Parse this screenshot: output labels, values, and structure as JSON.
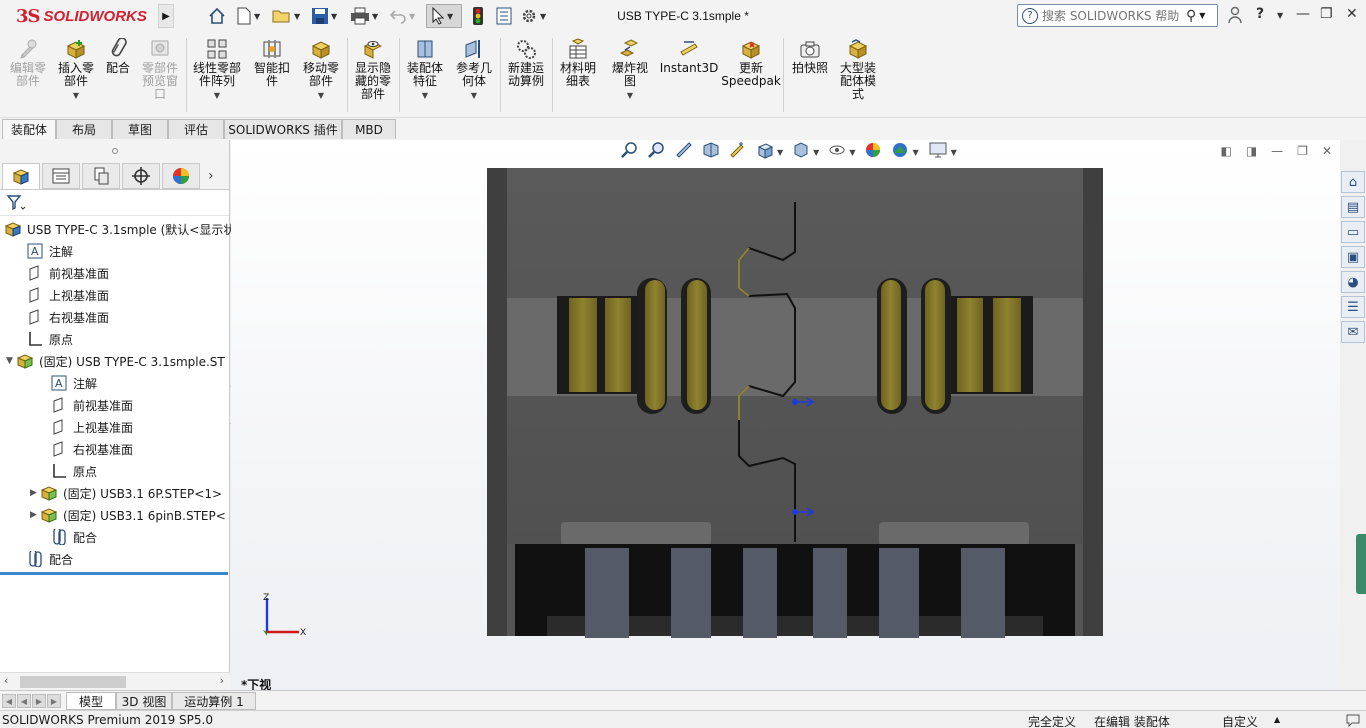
{
  "app": {
    "brand_ds": "3S",
    "brand_name": "SOLIDWORKS"
  },
  "title_bar": {
    "document_title": "USB TYPE-C 3.1smple *",
    "search_placeholder": "搜索 SOLIDWORKS 帮助"
  },
  "ribbon": {
    "buttons": [
      {
        "label": "编辑零\n部件",
        "icon": "edit-component-icon",
        "enabled": false
      },
      {
        "label": "插入零\n部件",
        "icon": "insert-component-icon",
        "enabled": true
      },
      {
        "label": "配合",
        "icon": "mate-icon",
        "enabled": true
      },
      {
        "label": "零部件\n预览窗\n口",
        "icon": "component-preview-icon",
        "enabled": false
      },
      {
        "label": "线性零部\n件阵列",
        "icon": "linear-pattern-icon",
        "enabled": true
      },
      {
        "label": "智能扣\n件",
        "icon": "smart-fasteners-icon",
        "enabled": true
      },
      {
        "label": "移动零\n部件",
        "icon": "move-component-icon",
        "enabled": true
      },
      {
        "label": "显示隐\n藏的零\n部件",
        "icon": "show-hidden-icon",
        "enabled": true
      },
      {
        "label": "装配体\n特征",
        "icon": "assembly-features-icon",
        "enabled": true
      },
      {
        "label": "参考几\n何体",
        "icon": "reference-geometry-icon",
        "enabled": true
      },
      {
        "label": "新建运\n动算例",
        "icon": "new-motion-study-icon",
        "enabled": true
      },
      {
        "label": "材料明\n细表",
        "icon": "bom-icon",
        "enabled": true
      },
      {
        "label": "爆炸视\n图",
        "icon": "exploded-view-icon",
        "enabled": true
      },
      {
        "label": "Instant3D",
        "icon": "instant3d-icon",
        "enabled": true
      },
      {
        "label": "更新\nSpeedpak",
        "icon": "speedpak-icon",
        "enabled": true
      },
      {
        "label": "拍快照",
        "icon": "snapshot-icon",
        "enabled": true
      },
      {
        "label": "大型装\n配体模\n式",
        "icon": "large-assembly-icon",
        "enabled": true
      }
    ]
  },
  "tabs": [
    "装配体",
    "布局",
    "草图",
    "评估",
    "SOLIDWORKS 插件",
    "MBD"
  ],
  "feature_tree": {
    "root": "USB TYPE-C 3.1smple  (默认<显示状",
    "items": [
      {
        "label": "注解",
        "icon": "annotation-icon"
      },
      {
        "label": "前视基准面",
        "icon": "plane-icon"
      },
      {
        "label": "上视基准面",
        "icon": "plane-icon"
      },
      {
        "label": "右视基准面",
        "icon": "plane-icon"
      },
      {
        "label": "原点",
        "icon": "origin-icon"
      },
      {
        "label": "(固定) USB TYPE-C 3.1smple.ST",
        "icon": "subassembly-icon"
      },
      {
        "label": "注解",
        "icon": "annotation-icon"
      },
      {
        "label": "前视基准面",
        "icon": "plane-icon"
      },
      {
        "label": "上视基准面",
        "icon": "plane-icon"
      },
      {
        "label": "右视基准面",
        "icon": "plane-icon"
      },
      {
        "label": "原点",
        "icon": "origin-icon"
      },
      {
        "label": "(固定) USB3.1 6P.STEP<1>",
        "icon": "subassembly-icon"
      },
      {
        "label": "(固定) USB3.1 6pinB.STEP<",
        "icon": "subassembly-icon"
      },
      {
        "label": "配合",
        "icon": "mates-folder-icon"
      },
      {
        "label": "配合",
        "icon": "mates-folder-icon"
      }
    ]
  },
  "viewport": {
    "view_label": "*下视",
    "triad_z": "Z",
    "triad_x": "X"
  },
  "bottom_tabs": [
    "模型",
    "3D 视图",
    "运动算例 1"
  ],
  "status_bar": {
    "product": "SOLIDWORKS Premium 2019 SP5.0",
    "definition": "完全定义",
    "editing": "在编辑 装配体",
    "units": "自定义"
  }
}
